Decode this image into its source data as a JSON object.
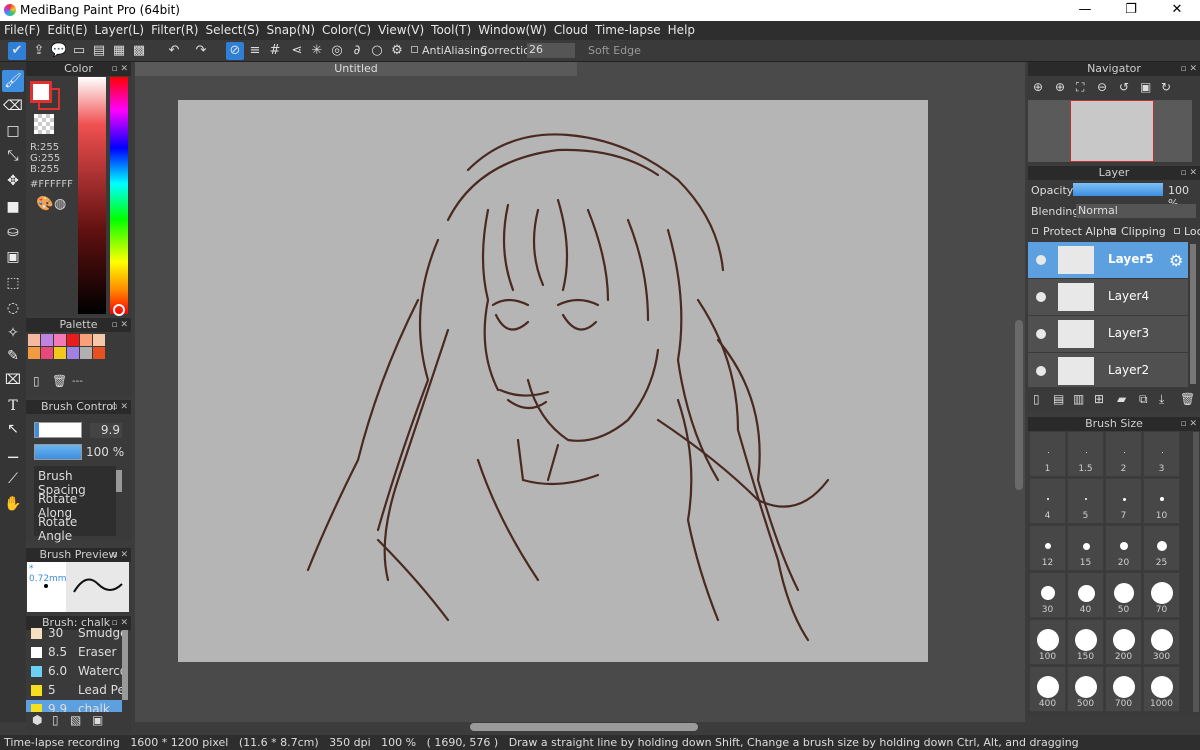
{
  "window": {
    "title": "MediBang Paint Pro (64bit)",
    "minimize": "—",
    "maximize": "❐",
    "close": "✕"
  },
  "menu": [
    "File(F)",
    "Edit(E)",
    "Layer(L)",
    "Filter(R)",
    "Select(S)",
    "Snap(N)",
    "Color(C)",
    "View(V)",
    "Tool(T)",
    "Window(W)",
    "Cloud",
    "Time-lapse",
    "Help"
  ],
  "toolbar": {
    "antialiasing": "AntiAliasing",
    "correction_label": "Correction",
    "correction_value": "26",
    "soft_edge": "Soft Edge"
  },
  "document": {
    "tab_title": "Untitled"
  },
  "color_panel": {
    "title": "Color",
    "r": "R:255",
    "g": "G:255",
    "b": "B:255",
    "hex": "#FFFFFF",
    "main_color": "#ffffff",
    "sub_color": "#e03030"
  },
  "palette_panel": {
    "title": "Palette",
    "colors": [
      "#f5b8a0",
      "#c084e0",
      "#f27ab8",
      "#e81c1c",
      "#f7a07a",
      "#f5c8a8",
      "#f29a40",
      "#e8487a",
      "#f2c81a",
      "#a080e0",
      "#b0b0b0",
      "#e85020"
    ],
    "footer": "---"
  },
  "brush_control": {
    "title": "Brush Control",
    "size": "9.9",
    "opacity": "100 %",
    "size_fill": 0.09,
    "opacity_fill": 1.0,
    "items": [
      "Brush Spacing",
      "Rotate Along",
      "Rotate Angle"
    ]
  },
  "brush_preview": {
    "title": "Brush Preview",
    "size": "* 0.72mm"
  },
  "brush_list": {
    "title": "Brush: chalk",
    "items": [
      {
        "size": "30",
        "name": "Smudge",
        "color": "#f5e0c0"
      },
      {
        "size": "8.5",
        "name": "Eraser",
        "color": "#ffffff"
      },
      {
        "size": "6.0",
        "name": "Waterco",
        "color": "#6ad0f5"
      },
      {
        "size": "5",
        "name": "Lead Pe",
        "color": "#f5e020"
      },
      {
        "size": "9.9",
        "name": "chalk",
        "color": "#f5e020"
      }
    ]
  },
  "navigator": {
    "title": "Navigator"
  },
  "layer_panel": {
    "title": "Layer",
    "opacity_label": "Opacity",
    "opacity_value": "100 %",
    "opacity_fill": 1.0,
    "blending_label": "Blending",
    "blending_value": "Normal",
    "protect_alpha": "Protect Alpha",
    "clipping": "Clipping",
    "lock": "Lock",
    "layers": [
      "Layer5",
      "Layer4",
      "Layer3",
      "Layer2"
    ]
  },
  "brush_size": {
    "title": "Brush Size",
    "sizes": [
      "1",
      "1.5",
      "2",
      "3",
      "4",
      "5",
      "7",
      "10",
      "12",
      "15",
      "20",
      "25",
      "30",
      "40",
      "50",
      "70",
      "100",
      "150",
      "200",
      "300",
      "400",
      "500",
      "700",
      "1000"
    ]
  },
  "status": {
    "recording": "Time-lapse recording",
    "size": "1600 * 1200 pixel",
    "dims": "(11.6 * 8.7cm)",
    "dpi": "350 dpi",
    "zoom": "100 %",
    "coord": "( 1690, 576 )",
    "hint": "Draw a straight line by holding down Shift, Change a brush size by holding down Ctrl, Alt, and dragging"
  }
}
